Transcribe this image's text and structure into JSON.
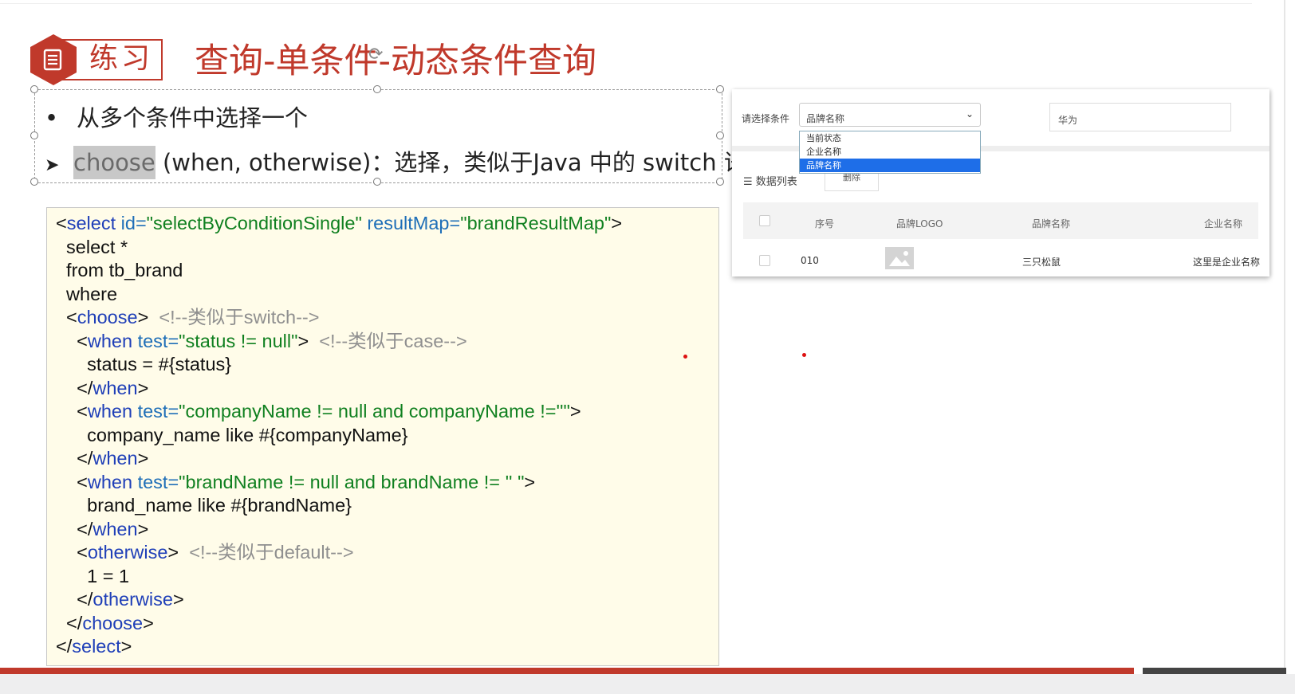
{
  "slide": {
    "badge_label": "练习",
    "title": "查询-单条件-动态条件查询",
    "bullet1": "从多个条件中选择一个",
    "bullet2_hl": "choose",
    "bullet2_rest": " (when, otherwise)：选择，类似于Java 中的 switch 语句"
  },
  "code": [
    [
      {
        "t": "<",
        "c": "p"
      },
      {
        "t": "select ",
        "c": "tg"
      },
      {
        "t": "id=",
        "c": "at"
      },
      {
        "t": "\"selectByConditionSingle\"",
        "c": "sv"
      },
      {
        "t": " resultMap=",
        "c": "at"
      },
      {
        "t": "\"brandResultMap\"",
        "c": "sv"
      },
      {
        "t": ">",
        "c": "p"
      }
    ],
    [
      {
        "t": "  select *",
        "c": "p"
      }
    ],
    [
      {
        "t": "  from tb_brand",
        "c": "p"
      }
    ],
    [
      {
        "t": "  where",
        "c": "p"
      }
    ],
    [
      {
        "t": "  <",
        "c": "p"
      },
      {
        "t": "choose",
        "c": "tg"
      },
      {
        "t": ">  ",
        "c": "p"
      },
      {
        "t": "<!--类似于switch-->",
        "c": "cm"
      }
    ],
    [
      {
        "t": "    <",
        "c": "p"
      },
      {
        "t": "when ",
        "c": "tg"
      },
      {
        "t": "test=",
        "c": "at"
      },
      {
        "t": "\"status != null\"",
        "c": "sv"
      },
      {
        "t": ">  ",
        "c": "p"
      },
      {
        "t": "<!--类似于case-->",
        "c": "cm"
      }
    ],
    [
      {
        "t": "      status = #{status}",
        "c": "p"
      }
    ],
    [
      {
        "t": "    </",
        "c": "p"
      },
      {
        "t": "when",
        "c": "tg"
      },
      {
        "t": ">",
        "c": "p"
      }
    ],
    [
      {
        "t": "    <",
        "c": "p"
      },
      {
        "t": "when ",
        "c": "tg"
      },
      {
        "t": "test=",
        "c": "at"
      },
      {
        "t": "\"companyName != null and companyName !=''\"",
        "c": "sv"
      },
      {
        "t": ">",
        "c": "p"
      }
    ],
    [
      {
        "t": "      company_name like #{companyName}",
        "c": "p"
      }
    ],
    [
      {
        "t": "    </",
        "c": "p"
      },
      {
        "t": "when",
        "c": "tg"
      },
      {
        "t": ">",
        "c": "p"
      }
    ],
    [
      {
        "t": "    <",
        "c": "p"
      },
      {
        "t": "when ",
        "c": "tg"
      },
      {
        "t": "test=",
        "c": "at"
      },
      {
        "t": "\"brandName != null and brandName != '' \"",
        "c": "sv"
      },
      {
        "t": ">",
        "c": "p"
      }
    ],
    [
      {
        "t": "      brand_name like #{brandName}",
        "c": "p"
      }
    ],
    [
      {
        "t": "    </",
        "c": "p"
      },
      {
        "t": "when",
        "c": "tg"
      },
      {
        "t": ">",
        "c": "p"
      }
    ],
    [
      {
        "t": "    <",
        "c": "p"
      },
      {
        "t": "otherwise",
        "c": "tg"
      },
      {
        "t": ">  ",
        "c": "p"
      },
      {
        "t": "<!--类似于default-->",
        "c": "cm"
      }
    ],
    [
      {
        "t": "      1 = 1",
        "c": "p"
      }
    ],
    [
      {
        "t": "    </",
        "c": "p"
      },
      {
        "t": "otherwise",
        "c": "tg"
      },
      {
        "t": ">",
        "c": "p"
      }
    ],
    [
      {
        "t": "  </",
        "c": "p"
      },
      {
        "t": "choose",
        "c": "tg"
      },
      {
        "t": ">",
        "c": "p"
      }
    ],
    [
      {
        "t": "</",
        "c": "p"
      },
      {
        "t": "select",
        "c": "tg"
      },
      {
        "t": ">",
        "c": "p"
      }
    ]
  ],
  "panel": {
    "condition_label": "请选择条件",
    "selected_value": "品牌名称",
    "options": [
      "当前状态",
      "企业名称",
      "品牌名称"
    ],
    "input_value": "华为",
    "list_label": "数据列表",
    "delete_button": "删除",
    "headers": {
      "num": "序号",
      "logo": "品牌LOGO",
      "brand": "品牌名称",
      "company": "企业名称"
    },
    "row": {
      "num": "010",
      "brand": "三只松鼠",
      "company": "这里是企业名称"
    }
  },
  "colors": {
    "accent": "#c0392b",
    "code_bg": "#fffce9",
    "tag": "#1f3fb8",
    "string": "#108020",
    "comment": "#8f8f8f",
    "select_highlight": "#1e6ee8"
  },
  "icons": {
    "badge": "document-icon",
    "rotate": "rotate-handle-icon",
    "list": "list-icon",
    "image_placeholder": "image-icon",
    "dropdown": "chevron-down-icon"
  }
}
